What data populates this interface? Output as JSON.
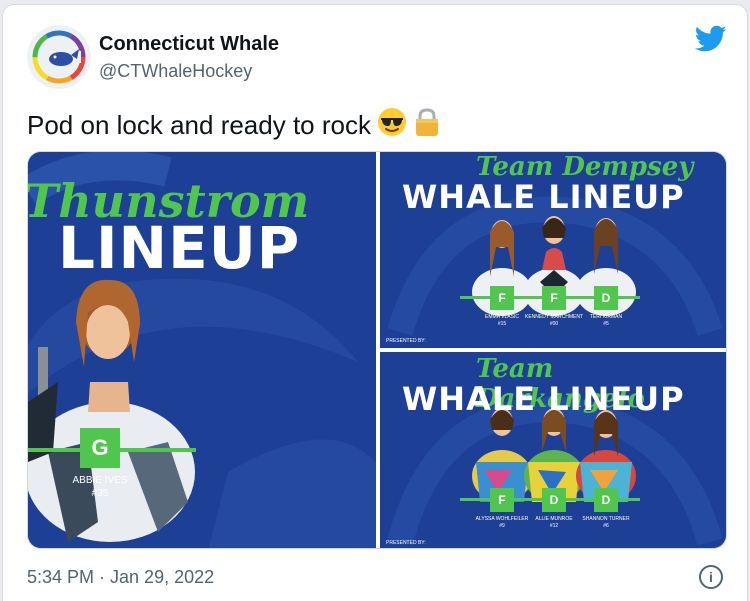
{
  "tweet": {
    "author_name": "Connecticut Whale",
    "author_handle": "@CTWhaleHockey",
    "text": "Pod on lock and ready to rock",
    "emojis": [
      "sunglasses-emoji",
      "lock-emoji"
    ],
    "timestamp": "5:34 PM · Jan 29, 2022",
    "icons": {
      "brand": "twitter-bird-icon",
      "info": "info-icon"
    },
    "brand_color": "#1d9bf0"
  },
  "media": {
    "left_panel": {
      "script_title": "Thunstrom",
      "block_title": "LINEUP",
      "position": "G",
      "player_name": "ABBIE IVES",
      "player_number": "#35"
    },
    "top_right_panel": {
      "script_title": "Team Dempsey",
      "block_title": "WHALE LINEUP",
      "positions": [
        "F",
        "F",
        "D"
      ],
      "players": [
        {
          "name": "EMMA VLASIC",
          "number": "#15"
        },
        {
          "name": "KENNEDY MARCHMENT",
          "number": "#00"
        },
        {
          "name": "TERI KIRMAN",
          "number": "#5"
        }
      ],
      "presented_by": "PRESENTED BY:"
    },
    "bottom_right_panel": {
      "script_title": "Team Darkangelo",
      "block_title": "WHALE LINEUP",
      "positions": [
        "F",
        "D",
        "D"
      ],
      "players": [
        {
          "name": "ALYSSA WOHLFEILER",
          "number": "#9"
        },
        {
          "name": "ALLIE MUNROE",
          "number": "#12"
        },
        {
          "name": "SHANNON TURNER",
          "number": "#6"
        }
      ],
      "presented_by": "PRESENTED BY:"
    },
    "colors": {
      "panel_blue": "#1d3f96",
      "accent_green": "#51c64f"
    }
  }
}
